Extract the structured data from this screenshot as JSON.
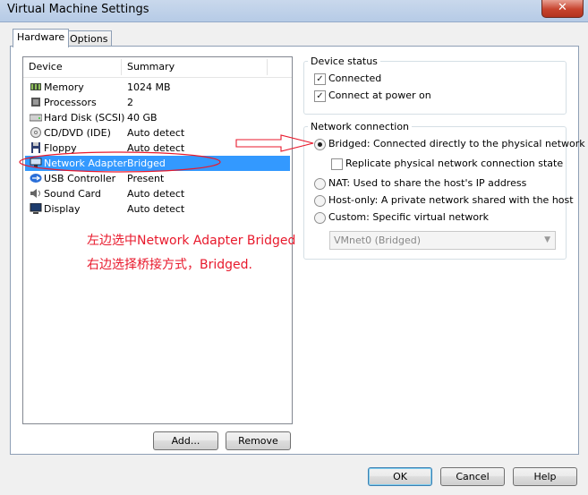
{
  "window": {
    "title": "Virtual Machine Settings",
    "close_glyph": "✕"
  },
  "tabs": [
    {
      "label": "Hardware",
      "active": true
    },
    {
      "label": "Options",
      "active": false
    }
  ],
  "device_list": {
    "columns": [
      "Device",
      "Summary"
    ],
    "rows": [
      {
        "icon": "memory-icon",
        "device": "Memory",
        "summary": "1024 MB",
        "selected": false
      },
      {
        "icon": "processor-icon",
        "device": "Processors",
        "summary": "2",
        "selected": false
      },
      {
        "icon": "hard-disk-icon",
        "device": "Hard Disk (SCSI)",
        "summary": "40 GB",
        "selected": false
      },
      {
        "icon": "cd-dvd-icon",
        "device": "CD/DVD (IDE)",
        "summary": "Auto detect",
        "selected": false
      },
      {
        "icon": "floppy-icon",
        "device": "Floppy",
        "summary": "Auto detect",
        "selected": false
      },
      {
        "icon": "network-adapter-icon",
        "device": "Network Adapter",
        "summary": "Bridged",
        "selected": true
      },
      {
        "icon": "usb-icon",
        "device": "USB Controller",
        "summary": "Present",
        "selected": false
      },
      {
        "icon": "sound-card-icon",
        "device": "Sound Card",
        "summary": "Auto detect",
        "selected": false
      },
      {
        "icon": "display-icon",
        "device": "Display",
        "summary": "Auto detect",
        "selected": false
      }
    ]
  },
  "list_buttons": {
    "add": "Add...",
    "remove": "Remove"
  },
  "device_status": {
    "title": "Device status",
    "connected": {
      "label": "Connected",
      "checked": true
    },
    "connect_at_power_on": {
      "label": "Connect at power on",
      "checked": true
    }
  },
  "network_connection": {
    "title": "Network connection",
    "bridged": {
      "label": "Bridged: Connected directly to the physical network",
      "selected": true
    },
    "replicate": {
      "label": "Replicate physical network connection state",
      "checked": false
    },
    "nat": {
      "label": "NAT: Used to share the host's IP address",
      "selected": false
    },
    "host_only": {
      "label": "Host-only: A private network shared with the host",
      "selected": false
    },
    "custom": {
      "label": "Custom: Specific virtual network",
      "selected": false
    },
    "custom_network_value": "VMnet0 (Bridged)"
  },
  "annotation": {
    "line1": "左边选中Network Adapter Bridged",
    "line2": "右边选择桥接方式，Bridged.",
    "color": "#e8192c"
  },
  "footer": {
    "ok": "OK",
    "cancel": "Cancel",
    "help": "Help"
  }
}
